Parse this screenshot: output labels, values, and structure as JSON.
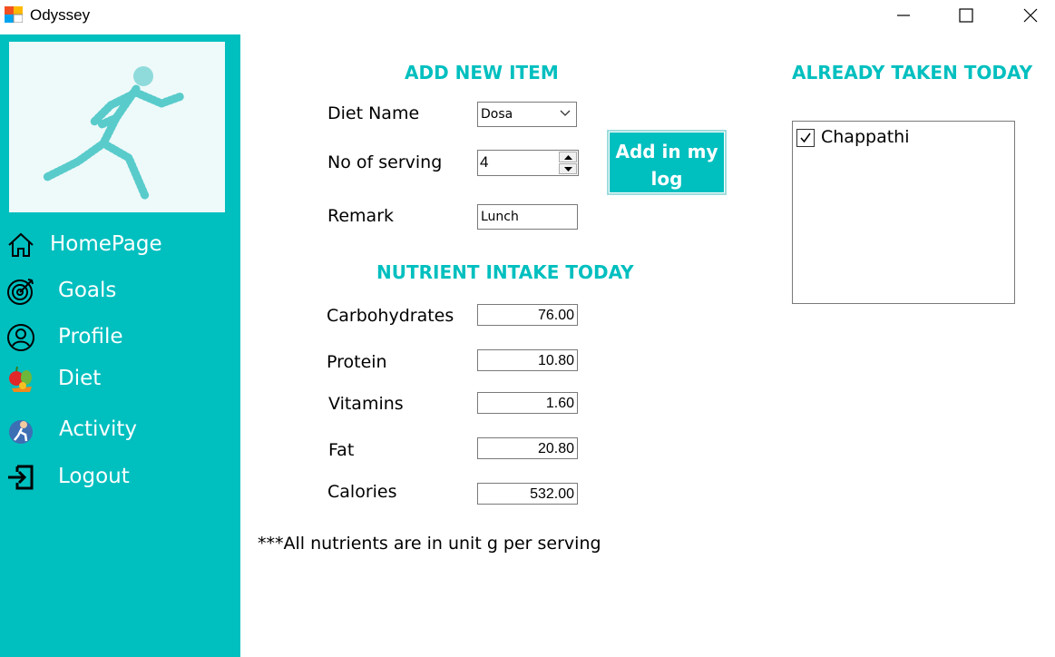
{
  "window": {
    "title": "Odyssey"
  },
  "sidebar": {
    "items": [
      {
        "label": "HomePage",
        "icon": "home-icon"
      },
      {
        "label": "Goals",
        "icon": "target-icon"
      },
      {
        "label": "Profile",
        "icon": "user-icon"
      },
      {
        "label": "Diet",
        "icon": "fruit-icon"
      },
      {
        "label": "Activity",
        "icon": "activity-icon"
      },
      {
        "label": "Logout",
        "icon": "logout-icon"
      }
    ]
  },
  "add_item": {
    "heading": "ADD NEW ITEM",
    "diet_name_label": "Diet Name",
    "diet_name_value": "Dosa",
    "serving_label": "No of serving",
    "serving_value": "4",
    "remark_label": "Remark",
    "remark_value": "Lunch",
    "add_button_line1": "Add in my",
    "add_button_line2": "log"
  },
  "nutrients": {
    "heading": "NUTRIENT INTAKE TODAY",
    "rows": [
      {
        "label": "Carbohydrates",
        "value": "76.00"
      },
      {
        "label": "Protein",
        "value": "10.80"
      },
      {
        "label": "Vitamins",
        "value": "1.60"
      },
      {
        "label": "Fat",
        "value": "20.80"
      },
      {
        "label": "Calories",
        "value": "532.00"
      }
    ],
    "footnote": "***All nutrients are in unit g per serving"
  },
  "taken_today": {
    "heading": "ALREADY TAKEN TODAY",
    "items": [
      {
        "label": "Chappathi",
        "checked": true
      }
    ]
  },
  "colors": {
    "accent": "#00bfbf"
  }
}
